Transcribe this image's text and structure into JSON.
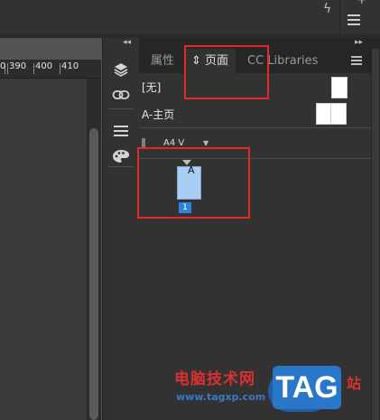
{
  "topbar": {
    "lightning_glyph": "ϟ",
    "plus_glyph": "+"
  },
  "ruler": {
    "labels": [
      "0",
      "390",
      "400",
      "410"
    ]
  },
  "toolbar": {
    "collapse_glyph": "◂◂",
    "icons": [
      "layers-icon",
      "links-icon",
      "lines-menu-icon",
      "palette-icon"
    ]
  },
  "panel": {
    "collapse_glyph": "▸▸",
    "tabs": [
      {
        "label": "属性",
        "active": false
      },
      {
        "label": "⇕ 页面",
        "active": true
      },
      {
        "label": "CC Libraries",
        "active": false
      }
    ],
    "none_label": "[无]",
    "master_label": "A-主页",
    "size_label": "A4 V",
    "size_caret": "▼",
    "page_master_letter": "A",
    "page_number": "1"
  },
  "watermark": {
    "site_name": "电脑技术网",
    "url": "www.tagxp.com",
    "tag": "TAG",
    "suffix": "站"
  },
  "colors": {
    "highlight_red": "#e8262a",
    "page_thumb_blue": "#a9cdf3",
    "page_number_blue": "#2f82d6",
    "tag_blue": "#2a77c9"
  }
}
